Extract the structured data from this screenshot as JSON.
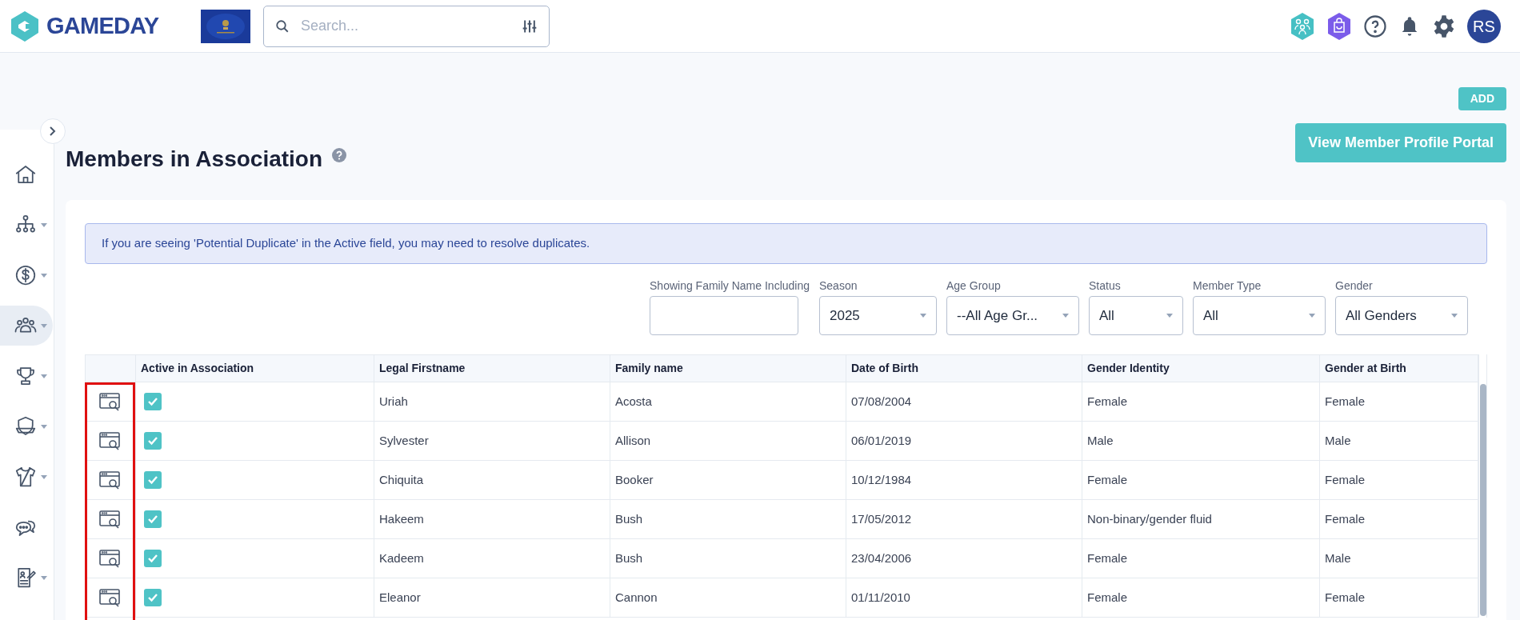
{
  "header": {
    "brand": "GAMEDAY",
    "search": {
      "placeholder": "Search..."
    },
    "avatar": "RS"
  },
  "sidebar": {
    "items": [
      {
        "selected": false,
        "has_submenu": false
      },
      {
        "selected": false,
        "has_submenu": true
      },
      {
        "selected": false,
        "has_submenu": true
      },
      {
        "selected": true,
        "has_submenu": true
      },
      {
        "selected": false,
        "has_submenu": true
      },
      {
        "selected": false,
        "has_submenu": true
      },
      {
        "selected": false,
        "has_submenu": true
      },
      {
        "selected": false,
        "has_submenu": false
      },
      {
        "selected": false,
        "has_submenu": true
      }
    ]
  },
  "page": {
    "title": "Members in Association",
    "add_button": "ADD",
    "portal_button": "View Member Profile Portal"
  },
  "alert": "If you are seeing 'Potential Duplicate' in the Active field, you may need to resolve duplicates.",
  "filters": [
    {
      "kind": "text",
      "label": "Showing Family Name Including"
    },
    {
      "kind": "select",
      "label": "Season",
      "value": "2025"
    },
    {
      "kind": "select",
      "label": "Age Group",
      "value": "--All Age Gr..."
    },
    {
      "kind": "select",
      "label": "Status",
      "value": "All"
    },
    {
      "kind": "select",
      "label": "Member Type",
      "value": "All"
    },
    {
      "kind": "select",
      "label": "Gender",
      "value": "All Genders"
    }
  ],
  "table": {
    "columns": [
      "",
      "Active in Association",
      "Legal Firstname",
      "Family name",
      "Date of Birth",
      "Gender Identity",
      "Gender at Birth"
    ],
    "highlight_view_column": true,
    "rows": [
      {
        "active": true,
        "cells": [
          "",
          "",
          "Uriah",
          "Acosta",
          "07/08/2004",
          "Female",
          "Female"
        ]
      },
      {
        "active": true,
        "cells": [
          "",
          "",
          "Sylvester",
          "Allison",
          "06/01/2019",
          "Male",
          "Male"
        ]
      },
      {
        "active": true,
        "cells": [
          "",
          "",
          "Chiquita",
          "Booker",
          "10/12/1984",
          "Female",
          "Female"
        ]
      },
      {
        "active": true,
        "cells": [
          "",
          "",
          "Hakeem",
          "Bush",
          "17/05/2012",
          "Non-binary/gender fluid",
          "Female"
        ]
      },
      {
        "active": true,
        "cells": [
          "",
          "",
          "Kadeem",
          "Bush",
          "23/04/2006",
          "Female",
          "Male"
        ]
      },
      {
        "active": true,
        "cells": [
          "",
          "",
          "Eleanor",
          "Cannon",
          "01/11/2010",
          "Female",
          "Female"
        ]
      }
    ]
  }
}
